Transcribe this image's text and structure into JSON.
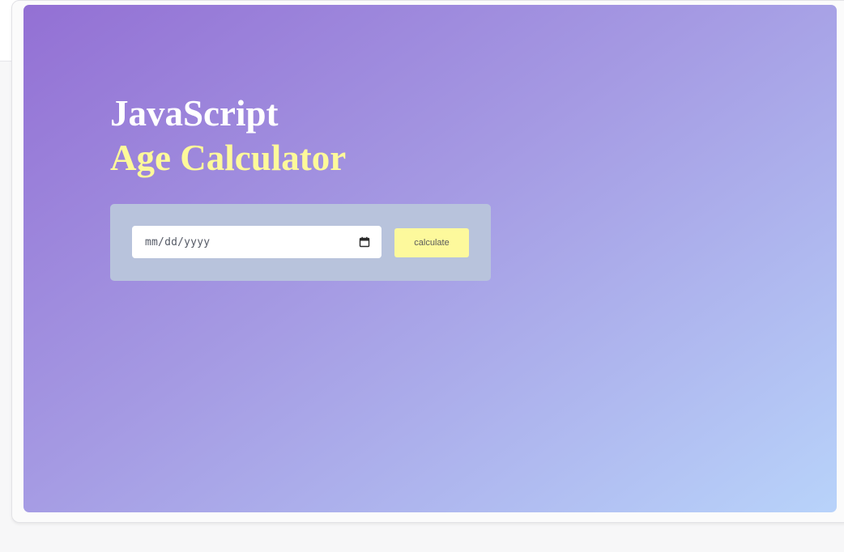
{
  "hero": {
    "title_line1": "JavaScript",
    "title_line2": "Age Calculator",
    "colors": {
      "gradient_start": "#9370d4",
      "gradient_end": "#b8d3fa",
      "title_primary": "#ffffff",
      "title_accent": "#fdf99a",
      "card_background": "#b8c3dc",
      "button_background": "#fdf99c"
    }
  },
  "form": {
    "date_input": {
      "placeholder": "mm/dd/yyyy",
      "value": "",
      "icon": "calendar-icon"
    },
    "calculate_label": "calculate"
  }
}
